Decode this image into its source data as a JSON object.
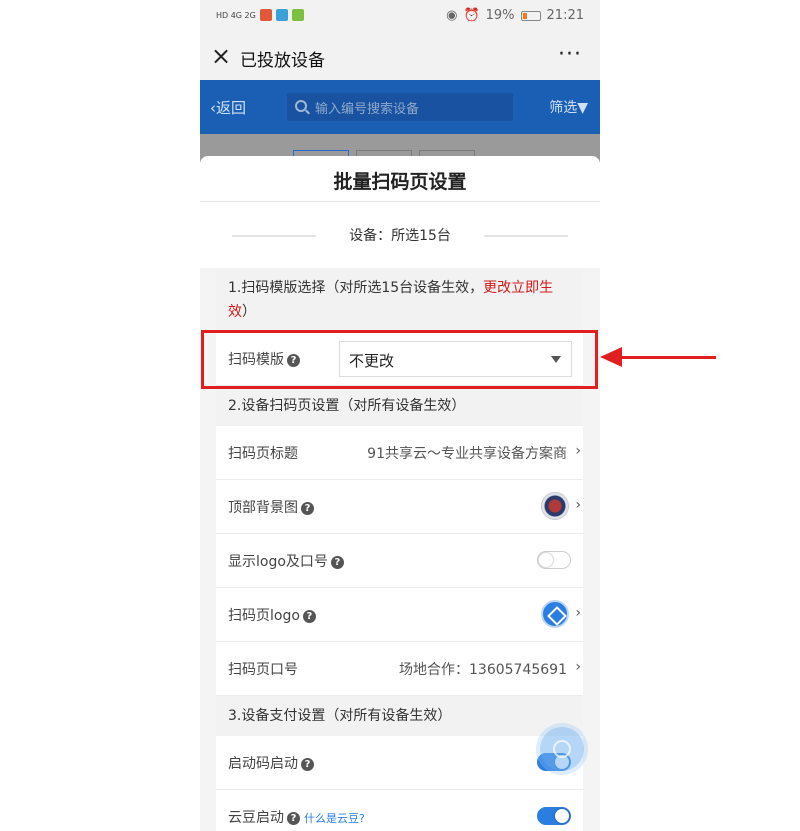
{
  "status_bar": {
    "battery": "19%",
    "time": "21:21",
    "network_left": "HD 4G 2G"
  },
  "wechat": {
    "title": "已投放设备",
    "more": "···"
  },
  "app_bar": {
    "back": "返回",
    "search_placeholder": "输入编号搜索设备",
    "filter": "筛选"
  },
  "sheet": {
    "title": "批量扫码页设置",
    "device_line": "设备：所选15台",
    "section1": {
      "text": "1.扫码模版选择（对所选15台设备生效，",
      "red": "更改立即生效",
      "tail": "）"
    },
    "template": {
      "label": "扫码模版",
      "value": "不更改"
    },
    "section2": "2.设备扫码页设置（对所有设备生效）",
    "rows": [
      {
        "label": "扫码页标题",
        "value": "91共享云～专业共享设备方案商"
      },
      {
        "label": "顶部背景图"
      },
      {
        "label": "显示logo及口号"
      },
      {
        "label": "扫码页logo"
      },
      {
        "label": "扫码页口号",
        "value": "场地合作：13605745691"
      }
    ],
    "section3": "3.设备支付设置（对所有设备生效）",
    "pay_rows": [
      {
        "label": "启动码启动",
        "on": true
      },
      {
        "label": "云豆启动",
        "help": "什么是云豆?",
        "on": true
      }
    ]
  },
  "colors": {
    "accent": "#2a7de1",
    "app_bar": "#1a5fb4",
    "annotation": "#e02020"
  }
}
